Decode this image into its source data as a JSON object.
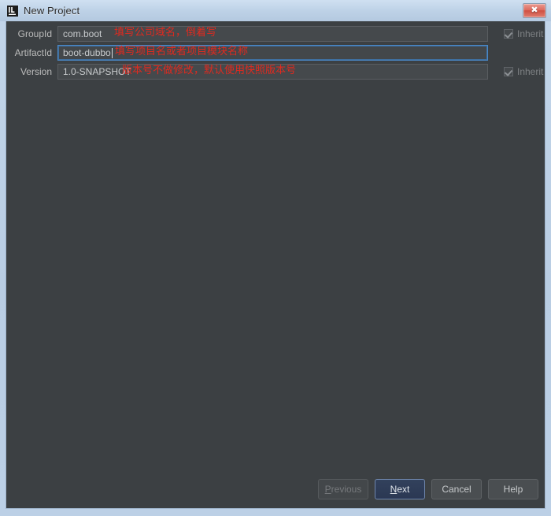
{
  "window": {
    "title": "New Project",
    "icon": "intellij-idea-icon",
    "close_label": "✖",
    "frame_color": "#bcd0e6",
    "client_bg": "#3c4043"
  },
  "form": {
    "rows": [
      {
        "label": "GroupId",
        "value": "com.boot",
        "annotation": "填写公司域名，倒着写",
        "focused": false,
        "inherit_label": "Inherit",
        "inherit_checked": true
      },
      {
        "label": "ArtifactId",
        "value": "boot-dubbo",
        "annotation": "填写项目名或者项目模块名称",
        "focused": true,
        "inherit_label": "",
        "inherit_checked": false
      },
      {
        "label": "Version",
        "value": "1.0-SNAPSHOT",
        "annotation": "版本号不做修改，默认使用快照版本号",
        "focused": false,
        "inherit_label": "Inherit",
        "inherit_checked": true
      }
    ],
    "annotation_color": "#e02a1f"
  },
  "buttons": {
    "previous": {
      "label": "Previous",
      "mnemonic": "P",
      "state": "disabled"
    },
    "next": {
      "label": "Next",
      "mnemonic": "N",
      "state": "default"
    },
    "cancel": {
      "label": "Cancel",
      "mnemonic": "",
      "state": "normal"
    },
    "help": {
      "label": "Help",
      "mnemonic": "",
      "state": "normal"
    }
  }
}
